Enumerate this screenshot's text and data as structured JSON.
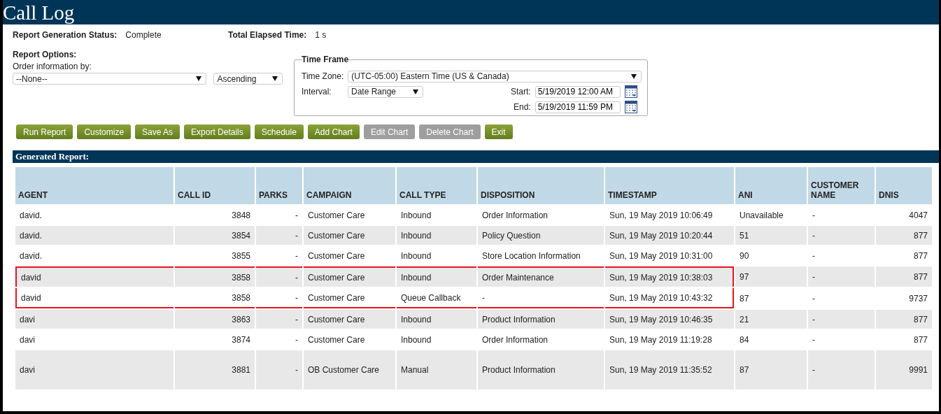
{
  "window": {
    "title": "Call Log"
  },
  "status": [
    {
      "label": "Report Generation Status:",
      "value": "Complete"
    },
    {
      "label": "Total Elapsed Time:",
      "value": "1 s"
    }
  ],
  "report_options": {
    "title": "Report Options:",
    "order_label": "Order information by:",
    "order_value": "--None--",
    "direction_value": "Ascending"
  },
  "time_frame": {
    "title": "Time Frame",
    "time_zone_label": "Time Zone:",
    "time_zone_value": "(UTC-05:00) Eastern Time (US & Canada)",
    "interval_label": "Interval:",
    "interval_value": "Date Range",
    "start_label": "Start:",
    "start_value": "5/19/2019 12:00 AM",
    "end_label": "End:",
    "end_value": "5/19/2019 11:59 PM"
  },
  "buttons": [
    {
      "label": "Run Report",
      "disabled": false
    },
    {
      "label": "Customize",
      "disabled": false
    },
    {
      "label": "Save As",
      "disabled": false
    },
    {
      "label": "Export Details",
      "disabled": false
    },
    {
      "label": "Schedule",
      "disabled": false
    },
    {
      "label": "Add Chart",
      "disabled": false
    },
    {
      "label": "Edit Chart",
      "disabled": true
    },
    {
      "label": "Delete Chart",
      "disabled": true
    },
    {
      "label": "Exit",
      "disabled": false
    }
  ],
  "report": {
    "title": "Generated Report:",
    "columns": [
      "AGENT",
      "CALL ID",
      "PARKS",
      "CAMPAIGN",
      "CALL TYPE",
      "DISPOSITION",
      "TIMESTAMP",
      "ANI",
      "CUSTOMER NAME",
      "DNIS"
    ],
    "rows": [
      {
        "highlighted": false,
        "cells": [
          "david.",
          "3848",
          "-",
          "Customer Care",
          "Inbound",
          "Order Information",
          "Sun, 19 May 2019 10:06:49",
          "Unavailable",
          "-",
          "4047"
        ]
      },
      {
        "highlighted": false,
        "cells": [
          "david.",
          "3854",
          "-",
          "Customer Care",
          "Inbound",
          "Policy Question",
          "Sun, 19 May 2019 10:20:44",
          "51",
          "-",
          "877"
        ]
      },
      {
        "highlighted": false,
        "cells": [
          "david.",
          "3855",
          "-",
          "Customer Care",
          "Inbound",
          "Store Location Information",
          "Sun, 19 May 2019 10:31:00",
          "90",
          "-",
          "877"
        ]
      },
      {
        "highlighted": true,
        "cells": [
          "david",
          "3858",
          "-",
          "Customer Care",
          "Inbound",
          "Order Maintenance",
          "Sun, 19 May 2019 10:38:03",
          "97",
          "-",
          "877"
        ]
      },
      {
        "highlighted": true,
        "cells": [
          "david",
          "3858",
          "-",
          "Customer Care",
          "Queue Callback",
          "-",
          "Sun, 19 May 2019 10:43:32",
          "87",
          "-",
          "9737"
        ]
      },
      {
        "highlighted": false,
        "cells": [
          "davi",
          "3863",
          "-",
          "Customer Care",
          "Inbound",
          "Product Information",
          "Sun, 19 May 2019 10:46:35",
          "21",
          "-",
          "877"
        ]
      },
      {
        "highlighted": false,
        "cells": [
          "davi",
          "3874",
          "-",
          "Customer Care",
          "Inbound",
          "Order Information",
          "Sun, 19 May 2019 11:19:28",
          "84",
          "-",
          "877"
        ]
      },
      {
        "highlighted": false,
        "tall": true,
        "cells": [
          "davi",
          "3881",
          "-",
          "OB Customer Care",
          "Manual",
          "Product Information",
          "Sun, 19 May 2019 11:35:52",
          "87",
          "-",
          "9991"
        ]
      }
    ]
  }
}
